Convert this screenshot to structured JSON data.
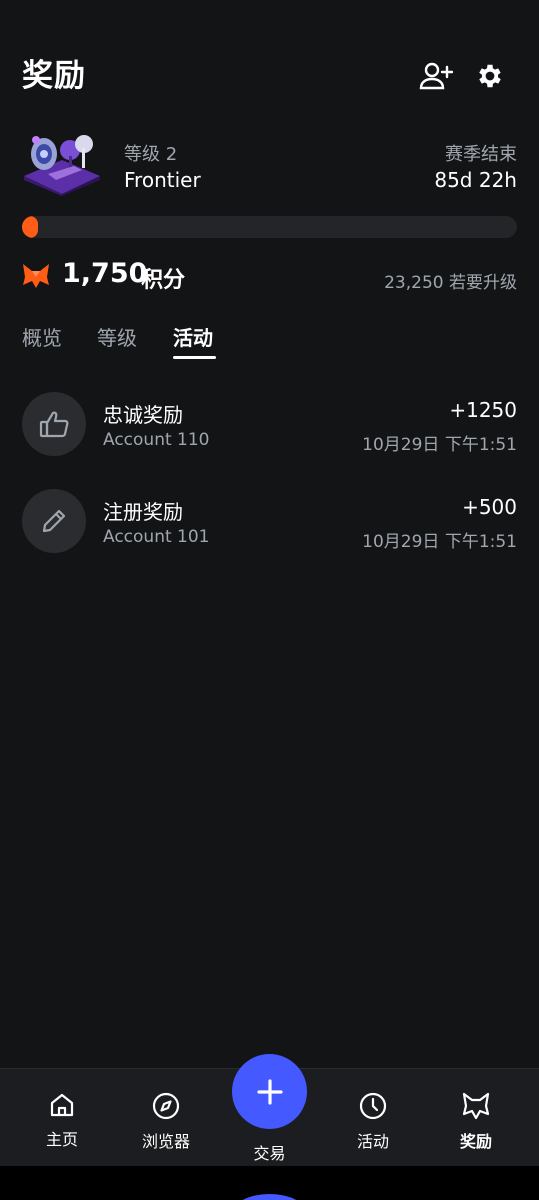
{
  "header": {
    "title": "奖励",
    "icons": [
      "add-user-icon",
      "gear-icon"
    ]
  },
  "season": {
    "level_label": "等级 2",
    "level_name": "Frontier",
    "end_label": "赛季结束",
    "end_time": "85d 22h",
    "progress": 0.03
  },
  "points": {
    "value": "1,750",
    "unit": "积分",
    "to_upgrade": "23,250 若要升级",
    "icon": "fox-icon"
  },
  "tabs": [
    {
      "label": "概览",
      "active": false
    },
    {
      "label": "等级",
      "active": false
    },
    {
      "label": "活动",
      "active": true
    }
  ],
  "activity": [
    {
      "title": "忠诚奖励",
      "account": "Account 110",
      "amount": "+1250",
      "time": "10月29日 下午1:51",
      "icon": "thumbs-up-icon"
    },
    {
      "title": "注册奖励",
      "account": "Account 101",
      "amount": "+500",
      "time": "10月29日 下午1:51",
      "icon": "pencil-icon"
    }
  ],
  "nav": {
    "items": [
      {
        "label": "主页",
        "icon": "home-icon"
      },
      {
        "label": "浏览器",
        "icon": "compass-icon"
      },
      {
        "label": "交易",
        "icon": "plus-icon"
      },
      {
        "label": "活动",
        "icon": "clock-icon"
      },
      {
        "label": "奖励",
        "icon": "fox-outline-icon"
      }
    ]
  },
  "colors": {
    "background": "#131416",
    "accent_orange": "#ff5c16",
    "accent_blue": "#4459ff",
    "muted_text": "#9fa6ae"
  }
}
